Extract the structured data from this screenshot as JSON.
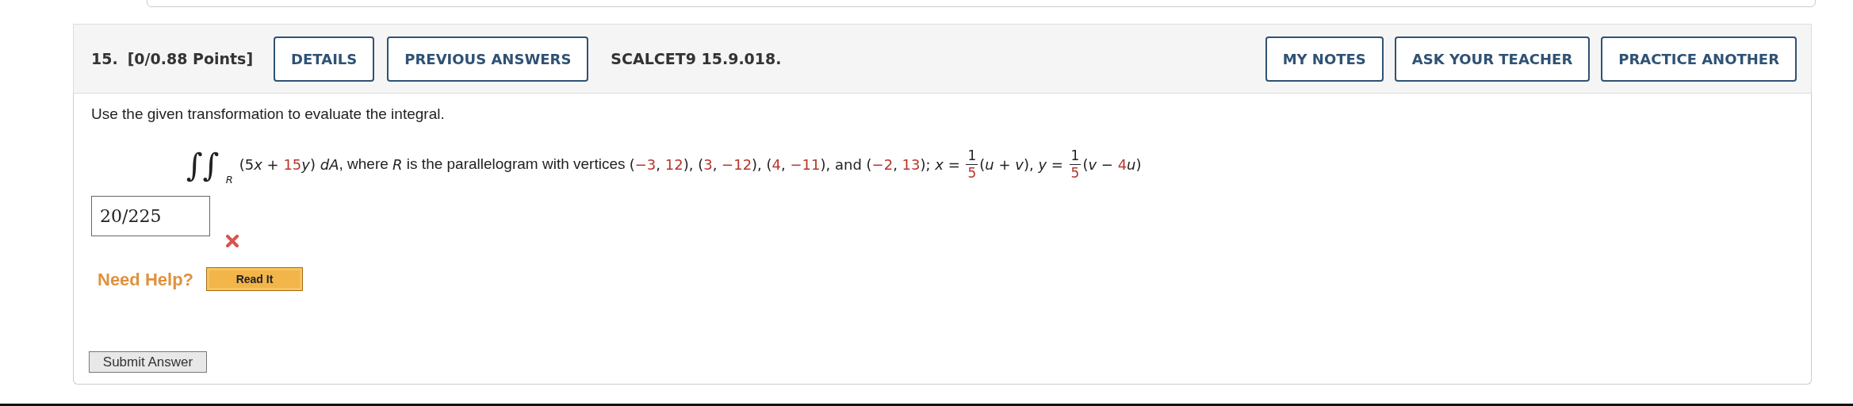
{
  "question": {
    "number": "15.",
    "points": "[0/0.88 Points]",
    "left_buttons": [
      "DETAILS",
      "PREVIOUS ANSWERS"
    ],
    "code": "SCALCET9 15.9.018.",
    "right_buttons": [
      "MY NOTES",
      "ASK YOUR TEACHER",
      "PRACTICE ANOTHER"
    ]
  },
  "prompt": "Use the given transformation to evaluate the integral.",
  "integral": {
    "sign": "∫∫",
    "region": "R"
  },
  "expression": [
    {
      "kind": "plain",
      "text": "(5"
    },
    {
      "kind": "var",
      "text": "x"
    },
    {
      "kind": "plain",
      "text": " + "
    },
    {
      "kind": "num",
      "text": "15"
    },
    {
      "kind": "var",
      "text": "y"
    },
    {
      "kind": "plain",
      "text": ") "
    },
    {
      "kind": "var",
      "text": "dA"
    },
    {
      "kind": "prose",
      "text": ", where "
    },
    {
      "kind": "var",
      "text": "R"
    },
    {
      "kind": "prose",
      "text": " is the parallelogram with vertices "
    },
    {
      "kind": "plain",
      "text": "("
    },
    {
      "kind": "num",
      "text": "−3"
    },
    {
      "kind": "plain",
      "text": ", "
    },
    {
      "kind": "num",
      "text": "12"
    },
    {
      "kind": "plain",
      "text": "), ("
    },
    {
      "kind": "num",
      "text": "3"
    },
    {
      "kind": "plain",
      "text": ", "
    },
    {
      "kind": "num",
      "text": "−12"
    },
    {
      "kind": "plain",
      "text": "), ("
    },
    {
      "kind": "num",
      "text": "4"
    },
    {
      "kind": "plain",
      "text": ", "
    },
    {
      "kind": "num",
      "text": "−11"
    },
    {
      "kind": "plain",
      "text": "), and ("
    },
    {
      "kind": "num",
      "text": "−2"
    },
    {
      "kind": "plain",
      "text": ", "
    },
    {
      "kind": "num",
      "text": "13"
    },
    {
      "kind": "plain",
      "text": "); "
    },
    {
      "kind": "var",
      "text": "x"
    },
    {
      "kind": "plain",
      "text": " = "
    },
    {
      "kind": "frac",
      "num": "1",
      "den": "5"
    },
    {
      "kind": "plain",
      "text": "("
    },
    {
      "kind": "var",
      "text": "u"
    },
    {
      "kind": "plain",
      "text": " + "
    },
    {
      "kind": "var",
      "text": "v"
    },
    {
      "kind": "plain",
      "text": "), "
    },
    {
      "kind": "var",
      "text": "y"
    },
    {
      "kind": "plain",
      "text": " = "
    },
    {
      "kind": "frac",
      "num": "1",
      "den": "5"
    },
    {
      "kind": "plain",
      "text": "("
    },
    {
      "kind": "var",
      "text": "v"
    },
    {
      "kind": "plain",
      "text": " − "
    },
    {
      "kind": "num",
      "text": "4"
    },
    {
      "kind": "var",
      "text": "u"
    },
    {
      "kind": "plain",
      "text": ")"
    }
  ],
  "answer": {
    "value": "20/225",
    "correct": false
  },
  "help": {
    "label": "Need Help?",
    "buttons": [
      "Read It"
    ]
  },
  "submit": "Submit Answer"
}
